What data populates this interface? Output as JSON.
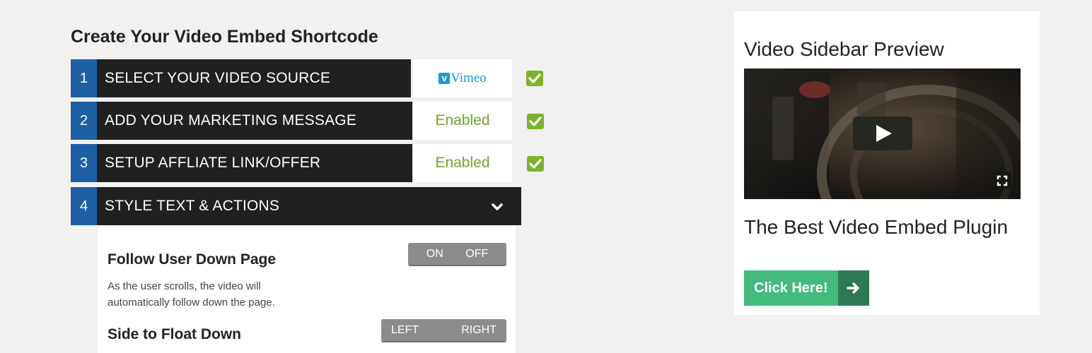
{
  "page_title": "Create Your Video Embed Shortcode",
  "steps": [
    {
      "number": "1",
      "label": "SELECT YOUR VIDEO SOURCE",
      "value": "Vimeo",
      "checked": true
    },
    {
      "number": "2",
      "label": "ADD YOUR MARKETING MESSAGE",
      "value": "Enabled",
      "checked": true
    },
    {
      "number": "3",
      "label": "SETUP AFFLIATE LINK/OFFER",
      "value": "Enabled",
      "checked": true
    },
    {
      "number": "4",
      "label": "STYLE TEXT & ACTIONS",
      "expanded": true
    }
  ],
  "style_panel": {
    "follow": {
      "title": "Follow User Down Page",
      "description": "As the user scrolls, the video will automatically follow down the page.",
      "on_label": "ON",
      "off_label": "OFF"
    },
    "side": {
      "title": "Side to Float Down",
      "left_label": "LEFT",
      "right_label": "RIGHT"
    }
  },
  "sidebar": {
    "title": "Video Sidebar Preview",
    "headline": "The Best Video Embed Plugin",
    "cta_label": "Click Here!",
    "icons": [
      "play-icon",
      "fullscreen-icon",
      "arrow-right-icon"
    ]
  },
  "colors": {
    "step_number_bg": "#1d5fa3",
    "step_bar_bg": "#202020",
    "enabled_text": "#6fa52b",
    "check_green": "#7cb32b",
    "cta_green": "#43ba7e",
    "cta_arrow_bg": "#2e7a55"
  }
}
